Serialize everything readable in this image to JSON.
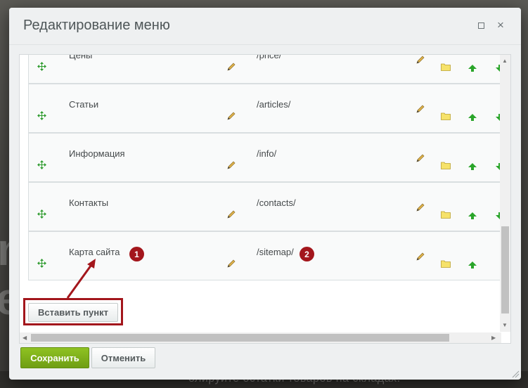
{
  "dialog": {
    "title": "Редактирование меню",
    "maximize_label": "",
    "close_label": "×"
  },
  "menu_items": [
    {
      "name": "Цены",
      "url": "/price/"
    },
    {
      "name": "Статьи",
      "url": "/articles/"
    },
    {
      "name": "Информация",
      "url": "/info/"
    },
    {
      "name": "Контакты",
      "url": "/contacts/"
    },
    {
      "name": "Карта сайта",
      "url": "/sitemap/"
    }
  ],
  "annotations": {
    "badge_name": "1",
    "badge_url": "2"
  },
  "insert_button_label": "Вставить пункт",
  "footer": {
    "save_label": "Сохранить",
    "cancel_label": "Отменить"
  },
  "background": {
    "text_strip": "олируйте остатки товаров на складах."
  },
  "colors": {
    "save_green": "#7cb01a",
    "annotation_red": "#a3161c",
    "arrow_green": "#2aa52a",
    "folder_yellow": "#f6e26a"
  },
  "icons": [
    "move-icon",
    "pencil-icon",
    "folder-icon",
    "arrow-up-icon",
    "arrow-down-icon",
    "maximize-icon",
    "close-icon",
    "resize-grip-icon"
  ]
}
